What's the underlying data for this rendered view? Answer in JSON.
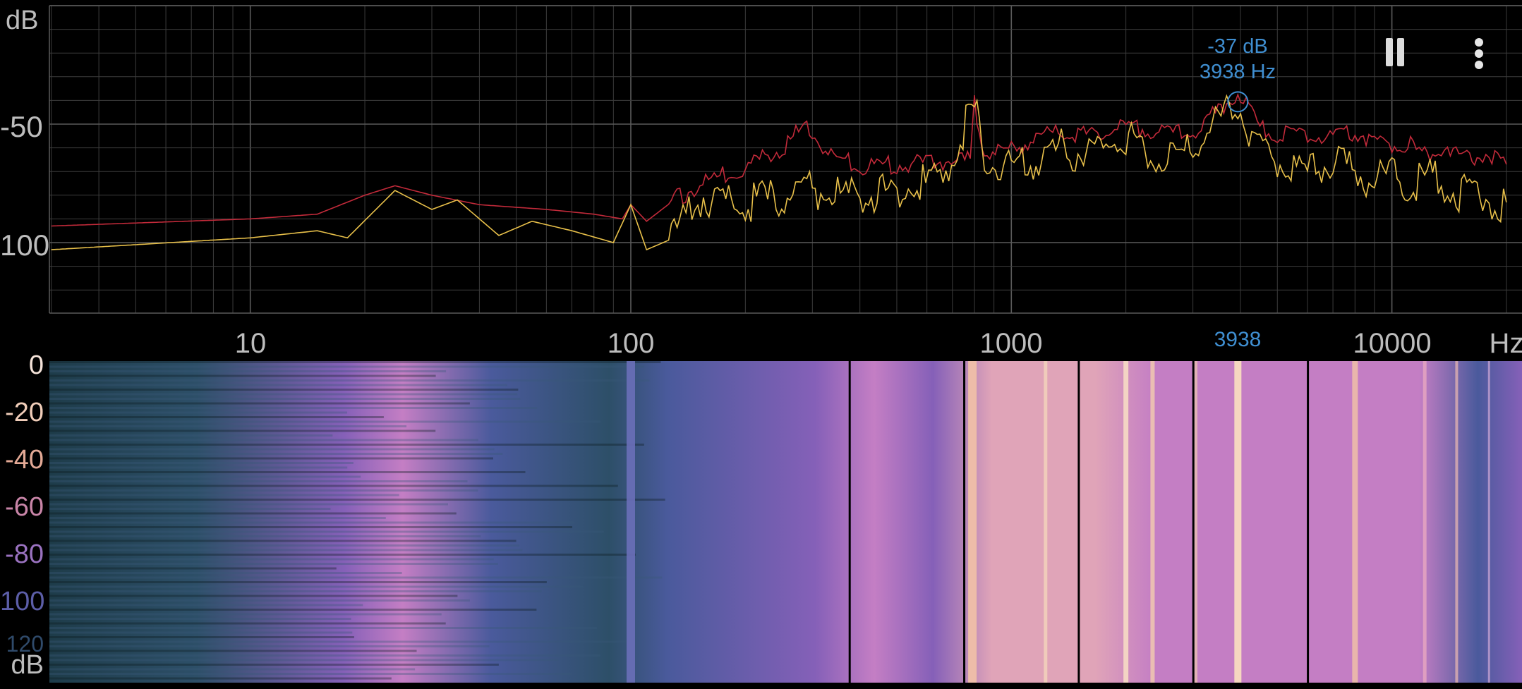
{
  "spectrum": {
    "y_unit": "dB",
    "y_tick_labels": [
      "-50",
      "100"
    ],
    "x_unit": "Hz",
    "x_tick_labels": [
      "10",
      "100",
      "1000",
      "10000"
    ],
    "cursor": {
      "db_label": "-37 dB",
      "hz_label": "3938 Hz",
      "axis_label": "3938"
    },
    "colors": {
      "peak_hold_line": "#c22a3a",
      "current_line": "#e8c04a",
      "grid": "#3c3c3c",
      "cursor": "#3f8ed0"
    }
  },
  "spectrogram": {
    "scale_unit": "dB",
    "scale_labels": [
      "0",
      "-20",
      "-40",
      "-60",
      "-80",
      "100",
      "120"
    ],
    "scale_colors": [
      "#f4e2d8",
      "#f0cdb9",
      "#e3a995",
      "#c985a8",
      "#9a72c0",
      "#5c5ea8",
      "#2f4a6a"
    ],
    "colormap": [
      "#0a1a1e",
      "#1e3c4a",
      "#2d4f68",
      "#4a5a9c",
      "#8560b8",
      "#c47ec4",
      "#e0a4b8",
      "#f3d3bd"
    ]
  },
  "toolbar": {
    "pause_icon": "pause-icon",
    "menu_icon": "more-vert-icon"
  },
  "chart_data": {
    "type": "line",
    "title": "",
    "xlabel": "Hz",
    "ylabel": "dB",
    "x_scale": "log",
    "xlim": [
      3,
      20000
    ],
    "x_ticks": [
      10,
      100,
      1000,
      10000
    ],
    "y_ticks": [
      -50,
      -100
    ],
    "grid": true,
    "series": [
      {
        "x": [
          3,
          10,
          15,
          20,
          24,
          30,
          40,
          60,
          80,
          95,
          100,
          110,
          130,
          160,
          200,
          250,
          290,
          330,
          400,
          500,
          650,
          780,
          800,
          850,
          1000,
          1200,
          1400,
          1600,
          2000,
          2400,
          3000,
          3938,
          4500,
          5000,
          6000,
          7000,
          8000,
          9000,
          10000,
          11000,
          12000,
          13000,
          14000,
          15000,
          16000,
          17000,
          18000,
          20000
        ],
        "y": [
          -93,
          -90,
          -88,
          -80,
          -76,
          -80,
          -84,
          -86,
          -88,
          -90,
          -84,
          -91,
          -82,
          -74,
          -68,
          -60,
          -50,
          -63,
          -68,
          -67,
          -66,
          -65,
          -41,
          -62,
          -61,
          -55,
          -53,
          -55,
          -51,
          -53,
          -54,
          -37,
          -51,
          -55,
          -54,
          -56,
          -53,
          -57,
          -59,
          -58,
          -63,
          -61,
          -58,
          -64,
          -65,
          -62,
          -63,
          -67
        ]
      },
      {
        "x": [
          3,
          10,
          15,
          18,
          24,
          30,
          35,
          45,
          55,
          70,
          90,
          100,
          110,
          130,
          150,
          200,
          300,
          400,
          500,
          650,
          800,
          850,
          1000,
          1200,
          1400,
          1600,
          2000,
          2400,
          3000,
          3938,
          4500,
          5000,
          6000,
          7000,
          8000,
          9000,
          10000,
          11000,
          12000,
          13000,
          14000,
          15000,
          16000,
          17000,
          18000,
          20000
        ],
        "y": [
          -103,
          -98,
          -95,
          -98,
          -78,
          -86,
          -82,
          -97,
          -91,
          -95,
          -100,
          -84,
          -103,
          -98,
          -80,
          -84,
          -78,
          -80,
          -79,
          -73,
          -43,
          -67,
          -70,
          -64,
          -60,
          -63,
          -56,
          -65,
          -60,
          -40,
          -63,
          -65,
          -70,
          -66,
          -70,
          -73,
          -71,
          -74,
          -73,
          -70,
          -76,
          -79,
          -80,
          -78,
          -82,
          -83
        ]
      }
    ]
  }
}
